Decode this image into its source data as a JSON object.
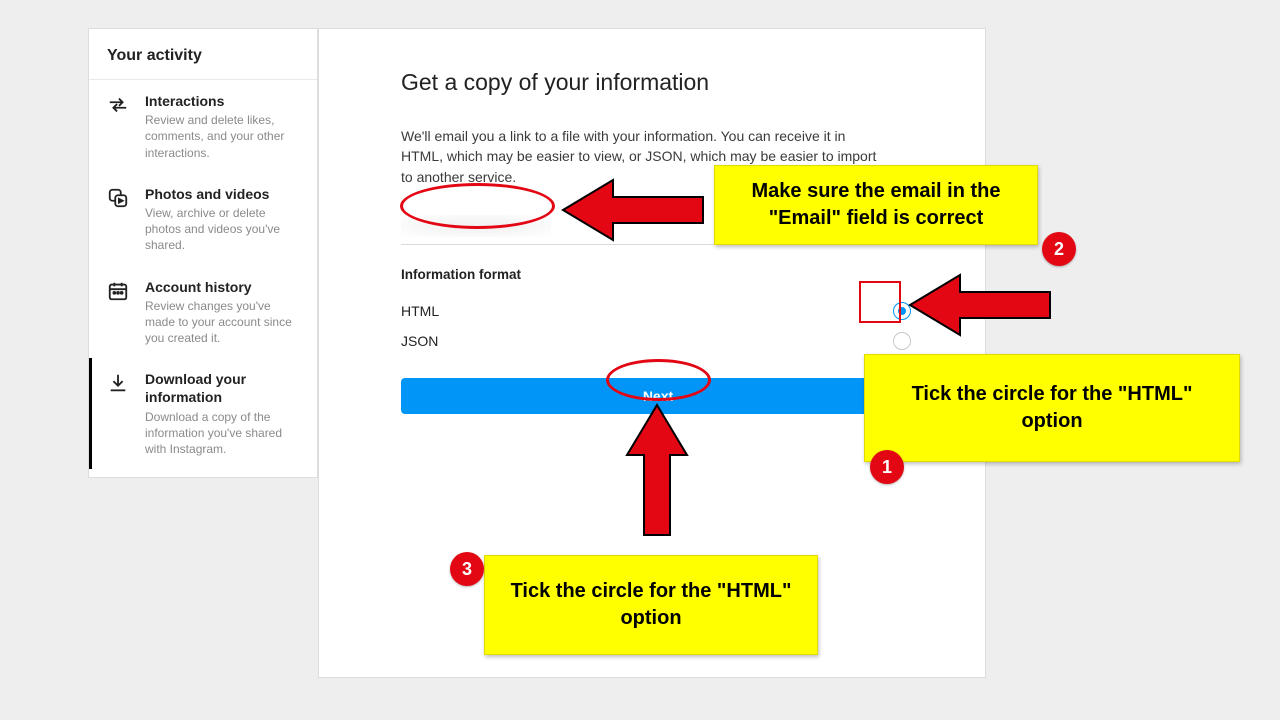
{
  "sidebar": {
    "title": "Your activity",
    "items": [
      {
        "label": "Interactions",
        "desc": "Review and delete likes, comments, and your other interactions."
      },
      {
        "label": "Photos and videos",
        "desc": "View, archive or delete photos and videos you've shared."
      },
      {
        "label": "Account history",
        "desc": "Review changes you've made to your account since you created it."
      },
      {
        "label": "Download your information",
        "desc": "Download a copy of the information you've shared with Instagram."
      }
    ]
  },
  "main": {
    "title": "Get a copy of your information",
    "desc": "We'll email you a link to a file with your information. You can receive it in HTML, which may be easier to view, or JSON, which may be easier to import to another service.",
    "format_label": "Information format",
    "options": {
      "html": "HTML",
      "json": "JSON"
    },
    "selected": "html",
    "next": "Next"
  },
  "annotations": {
    "note_email": "Make sure the email in the \"Email\" field is correct",
    "note_html": "Tick the circle for the \"HTML\" option",
    "note_next": "Tick the circle for the \"HTML\" option",
    "badge1": "1",
    "badge2": "2",
    "badge3": "3"
  }
}
